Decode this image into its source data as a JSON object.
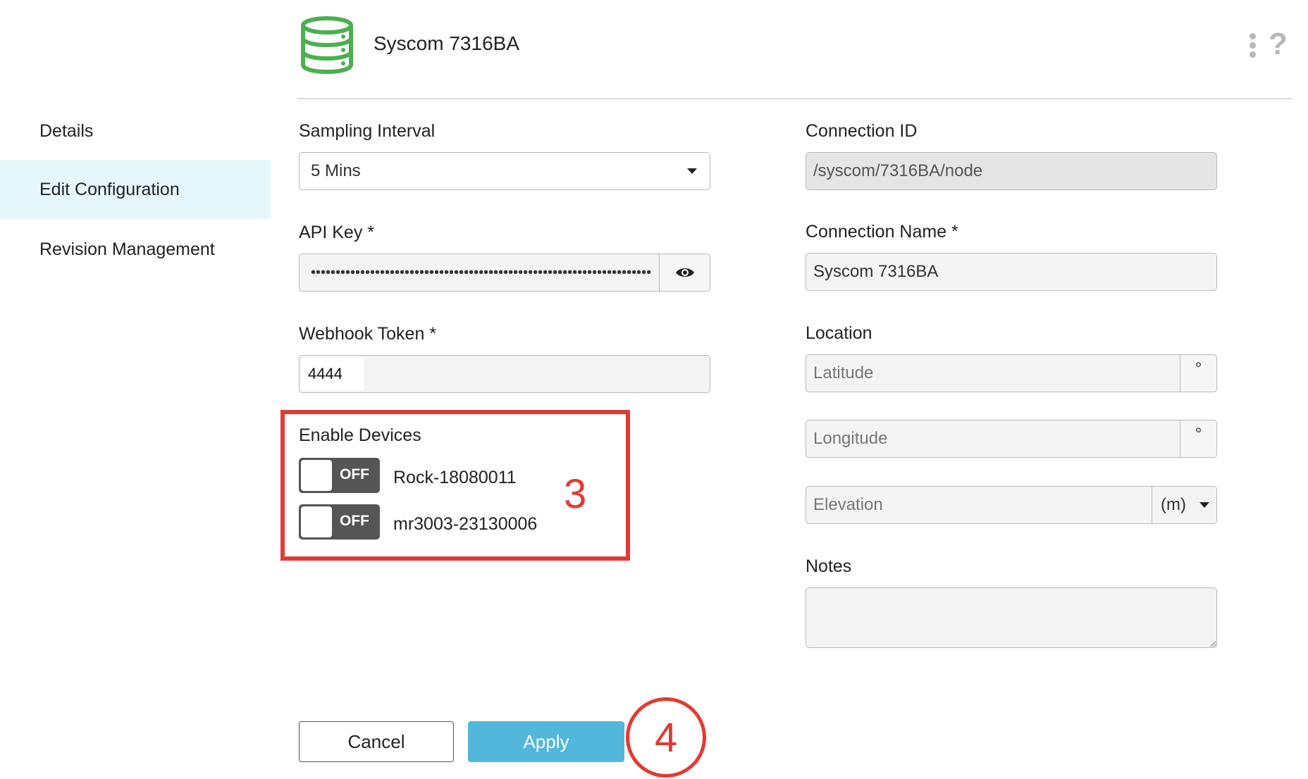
{
  "header": {
    "title": "Syscom 7316BA",
    "icon": "database-icon",
    "icon_color": "#4caf50"
  },
  "sidebar": {
    "items": [
      {
        "label": "Details",
        "active": false
      },
      {
        "label": "Edit Configuration",
        "active": true
      },
      {
        "label": "Revision Management",
        "active": false
      }
    ]
  },
  "form": {
    "sampling_interval": {
      "label": "Sampling Interval",
      "value": "5 Mins"
    },
    "api_key": {
      "label": "API Key *",
      "value": "•••••••••••••••••••••••••••••••••••••••••••••••••••••••••••••••••••••"
    },
    "webhook_token": {
      "label": "Webhook Token *",
      "value": "4444"
    },
    "enable_devices": {
      "label": "Enable Devices",
      "devices": [
        {
          "name": "Rock-18080011",
          "state": "OFF"
        },
        {
          "name": "mr3003-23130006",
          "state": "OFF"
        }
      ]
    },
    "connection_id": {
      "label": "Connection ID",
      "value": "/syscom/7316BA/node"
    },
    "connection_name": {
      "label": "Connection Name *",
      "value": "Syscom 7316BA"
    },
    "location": {
      "label": "Location",
      "latitude_placeholder": "Latitude",
      "longitude_placeholder": "Longitude",
      "elevation_placeholder": "Elevation",
      "degree_symbol": "°",
      "elevation_unit": "(m)"
    },
    "notes": {
      "label": "Notes",
      "value": ""
    }
  },
  "buttons": {
    "cancel": "Cancel",
    "apply": "Apply"
  },
  "annotations": {
    "step_3": "3",
    "step_4": "4",
    "color": "#e33a32"
  },
  "colors": {
    "accent": "#52b7db",
    "active_sidebar": "#e6f8fc",
    "toggle_off": "#555555"
  }
}
